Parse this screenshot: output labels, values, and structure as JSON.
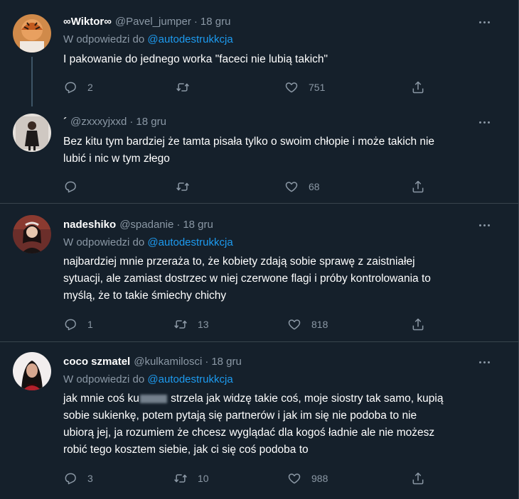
{
  "tweets": [
    {
      "name": "∞Wiktor∞",
      "handle": "@Pavel_jumper",
      "dot": "·",
      "time": "18 gru",
      "reply_prefix": "W odpowiedzi do",
      "reply_mention": "@autodestrukkcja",
      "text": "I pakowanie do jednego worka \"faceci nie lubią takich\"",
      "replies": "2",
      "retweets": "",
      "likes": "751",
      "avatar_color": "#c7773e"
    },
    {
      "name": "´",
      "handle": "@zxxxyjxxd",
      "dot": "·",
      "time": "18 gru",
      "text_line1": "Bez kitu tym bardziej że tamta pisała tylko o swoim chłopie i może takich nie",
      "text_line2": "lubić i nic w tym złego",
      "replies": "",
      "retweets": "",
      "likes": "68",
      "avatar_color": "#d9d4cf"
    },
    {
      "name": "nadeshiko",
      "handle": "@spadanie",
      "dot": "·",
      "time": "18 gru",
      "reply_prefix": "W odpowiedzi do",
      "reply_mention": "@autodestrukkcja",
      "text_line1": "najbardziej mnie przeraża to, że kobiety zdają sobie sprawę z zaistniałej",
      "text_line2": "sytuacji, ale zamiast dostrzec w niej czerwone flagi i próby kontrolowania to",
      "text_line3": "myślą, że to takie śmiechy chichy",
      "replies": "1",
      "retweets": "13",
      "likes": "818",
      "avatar_color": "#5a2a2a"
    },
    {
      "name": "coco szmatel",
      "handle": "@kulkamilosci",
      "dot": "·",
      "time": "18 gru",
      "reply_prefix": "W odpowiedzi do",
      "reply_mention": "@autodestrukkcja",
      "text_line1_a": "jak mnie coś ku",
      "text_line1_b": " strzela jak widzę takie coś, moje siostry tak samo, kupią",
      "text_line2": "sobie sukienkę, potem pytają się partnerów i jak im się nie podoba to nie",
      "text_line3": "ubiorą jej, ja rozumiem że chcesz wyglądać dla kogoś ładnie ale nie możesz",
      "text_line4": "robić tego kosztem siebie, jak ci się coś podoba to",
      "replies": "3",
      "retweets": "10",
      "likes": "988",
      "avatar_color": "#1a1a1a"
    }
  ],
  "colors": {
    "background": "#15202b",
    "border": "#38444d",
    "muted": "#8b98a5",
    "accent": "#1d9bf0"
  },
  "icons": [
    "reply-icon",
    "retweet-icon",
    "like-icon",
    "share-icon",
    "more-icon"
  ]
}
